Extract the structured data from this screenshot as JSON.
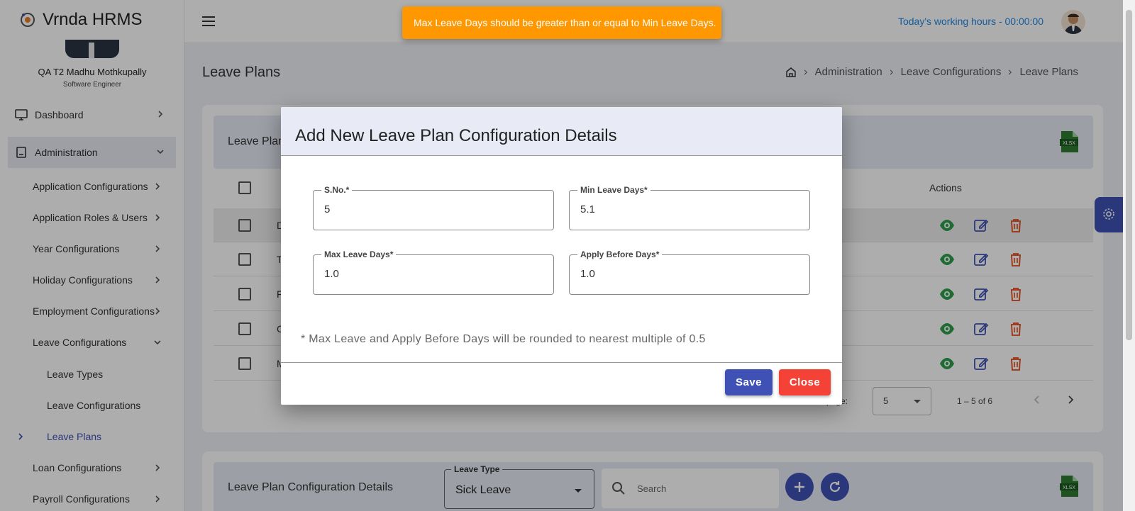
{
  "brand": {
    "name": "Vrnda HRMS"
  },
  "user": {
    "name": "QA T2 Madhu Mothkupally",
    "role": "Software Engineer"
  },
  "sidebar": {
    "main": [
      {
        "label": "Dashboard"
      },
      {
        "label": "Administration"
      }
    ],
    "admin_items": [
      {
        "label": "Application Configurations"
      },
      {
        "label": "Application Roles & Users"
      },
      {
        "label": "Year Configurations"
      },
      {
        "label": "Holiday Configurations"
      },
      {
        "label": "Employment Configurations"
      },
      {
        "label": "Leave Configurations"
      }
    ],
    "leave_items": [
      {
        "label": "Leave Types"
      },
      {
        "label": "Leave Configurations"
      },
      {
        "label": "Leave Plans"
      }
    ],
    "more_items": [
      {
        "label": "Loan Configurations"
      },
      {
        "label": "Payroll Configurations"
      }
    ]
  },
  "header": {
    "working_hours": "Today's working hours - 00:00:00"
  },
  "page": {
    "title": "Leave Plans"
  },
  "breadcrumb": [
    "Administration",
    "Leave Configurations",
    "Leave Plans"
  ],
  "leave_plans_card": {
    "title": "Leave Plans",
    "actions_header": "Actions",
    "row_initials": [
      "D",
      "T",
      "F",
      "C",
      "M"
    ],
    "xlsx_label": "XLSX",
    "rows_per_page_label": "page:",
    "rows_per_page": "5",
    "range": "1 – 5 of 6"
  },
  "config_card": {
    "title": "Leave Plan Configuration Details",
    "leave_type_label": "Leave Type",
    "leave_type_value": "Sick Leave",
    "search_placeholder": "Search",
    "xlsx_label": "XLSX"
  },
  "toast": {
    "message": "Max Leave Days should be greater than or equal to Min Leave Days."
  },
  "modal": {
    "title": "Add New Leave Plan Configuration Details",
    "fields": [
      {
        "label": "S.No.*",
        "value": "5"
      },
      {
        "label": "Min Leave Days*",
        "value": "5.1"
      },
      {
        "label": "Max Leave Days*",
        "value": "1.0"
      },
      {
        "label": "Apply Before Days*",
        "value": "1.0"
      }
    ],
    "note": "* Max Leave and Apply Before Days will be rounded to nearest multiple of 0.5",
    "save_label": "Save",
    "close_label": "Close"
  },
  "colors": {
    "primary": "#3f51b5",
    "danger": "#f44336",
    "warning": "#ff9800",
    "view": "#2e9e4d",
    "link": "#1e88e5"
  }
}
